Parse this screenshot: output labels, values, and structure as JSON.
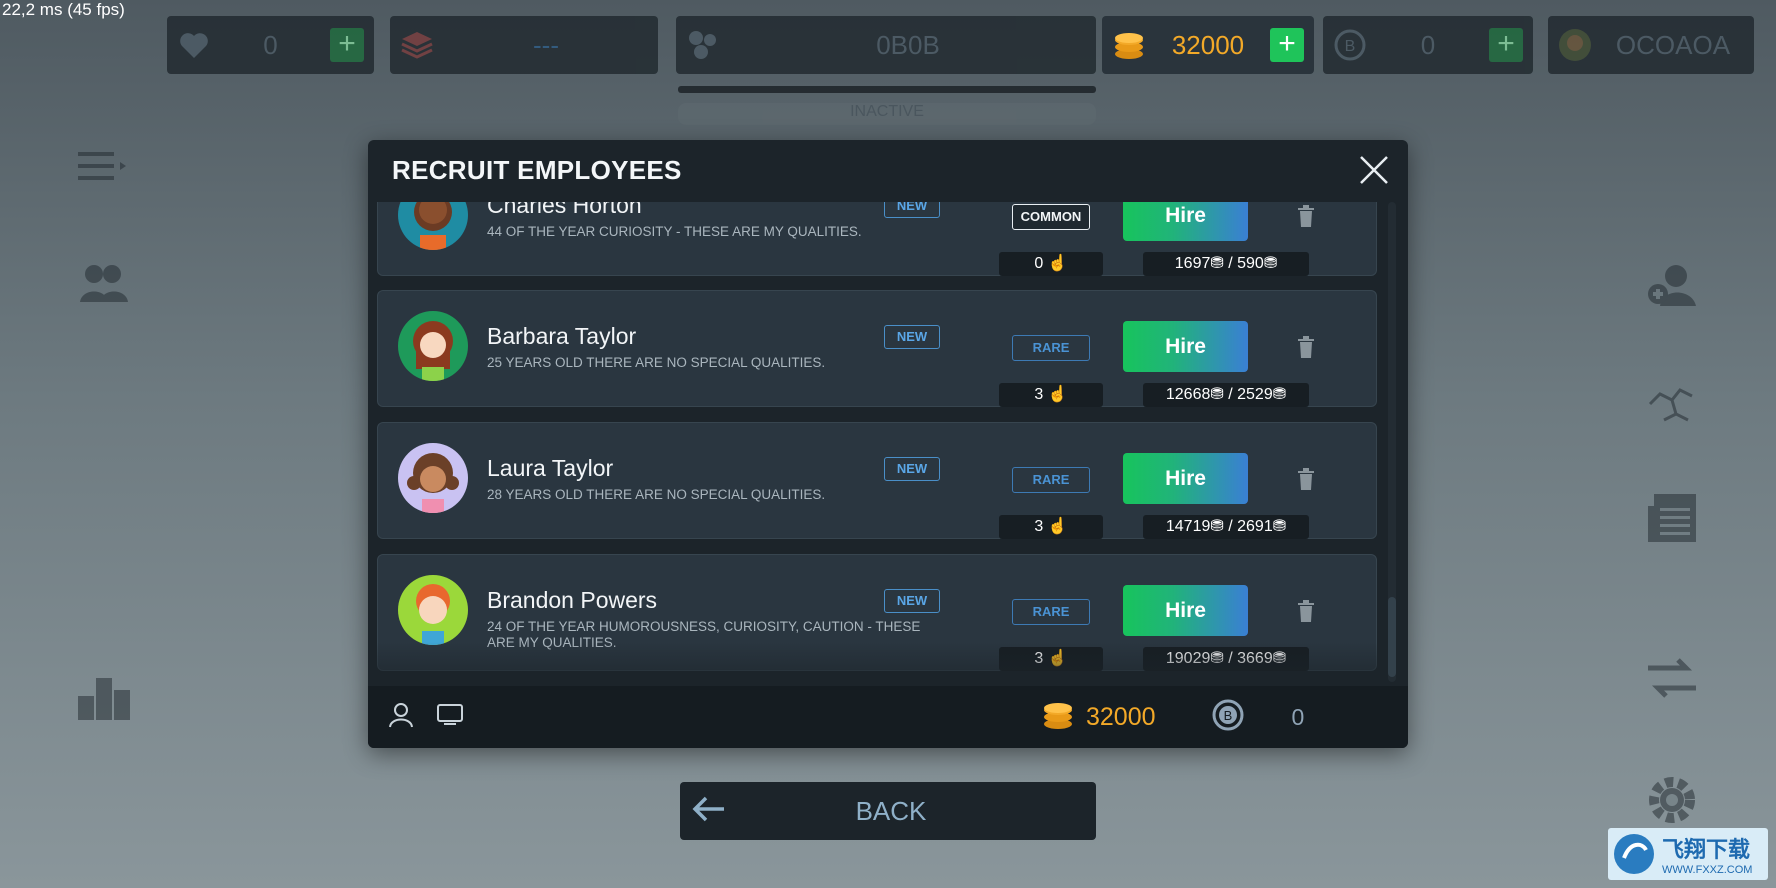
{
  "fps": "22,2 ms (45 fps)",
  "top_bar": {
    "hearts_value": "0",
    "stack_value": "---",
    "hex_value": "0B0B",
    "coins_value": "32000",
    "bitcoin_value": "0",
    "player_name": "OCOAOA"
  },
  "status": "INACTIVE",
  "modal": {
    "title": "RECRUIT EMPLOYEES",
    "employees": [
      {
        "name": "Charles Horton",
        "description": "44 OF THE YEAR CURIOSITY - THESE ARE MY QUALITIES.",
        "tag": "NEW",
        "rarity": "COMMON",
        "hire_label": "Hire",
        "clicks": "0",
        "cost_a": "1697",
        "cost_b": "590"
      },
      {
        "name": "Barbara Taylor",
        "description": "25 YEARS OLD THERE ARE NO SPECIAL QUALITIES.",
        "tag": "NEW",
        "rarity": "RARE",
        "hire_label": "Hire",
        "clicks": "3",
        "cost_a": "12668",
        "cost_b": "2529"
      },
      {
        "name": "Laura Taylor",
        "description": "28 YEARS OLD THERE ARE NO SPECIAL QUALITIES.",
        "tag": "NEW",
        "rarity": "RARE",
        "hire_label": "Hire",
        "clicks": "3",
        "cost_a": "14719",
        "cost_b": "2691"
      },
      {
        "name": "Brandon Powers",
        "description": "24 OF THE YEAR HUMOROUSNESS, CURIOSITY, CAUTION - THESE ARE MY QUALITIES.",
        "tag": "NEW",
        "rarity": "RARE",
        "hire_label": "Hire",
        "clicks": "3",
        "cost_a": "19029",
        "cost_b": "3669"
      }
    ],
    "footer": {
      "coins": "32000",
      "bitcoin": "0"
    }
  },
  "back_label": "BACK",
  "watermark": {
    "text": "飞翔下载",
    "url": "WWW.FXXZ.COM"
  },
  "colors": {
    "hire_green": "#17c45c",
    "hire_blue": "#3a7fd4",
    "coin": "#f3a928",
    "rare_blue": "#4a93d4"
  }
}
